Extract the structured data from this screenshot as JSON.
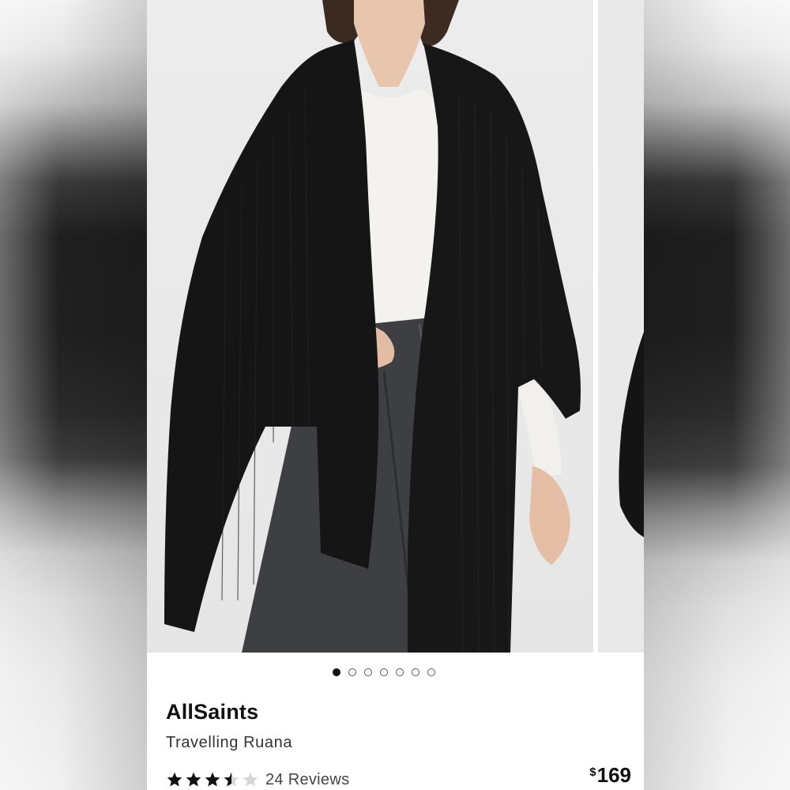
{
  "carousel": {
    "slide_count": 7,
    "active_index": 0
  },
  "product": {
    "brand": "AllSaints",
    "name": "Travelling Ruana",
    "rating": 3.5,
    "rating_max": 5,
    "reviews_label": "24 Reviews",
    "currency_symbol": "$",
    "price": "169"
  },
  "icons": {
    "star": "star-icon"
  },
  "colors": {
    "star_filled": "#111111",
    "star_empty": "#d6d6d6",
    "background": "#ffffff"
  }
}
